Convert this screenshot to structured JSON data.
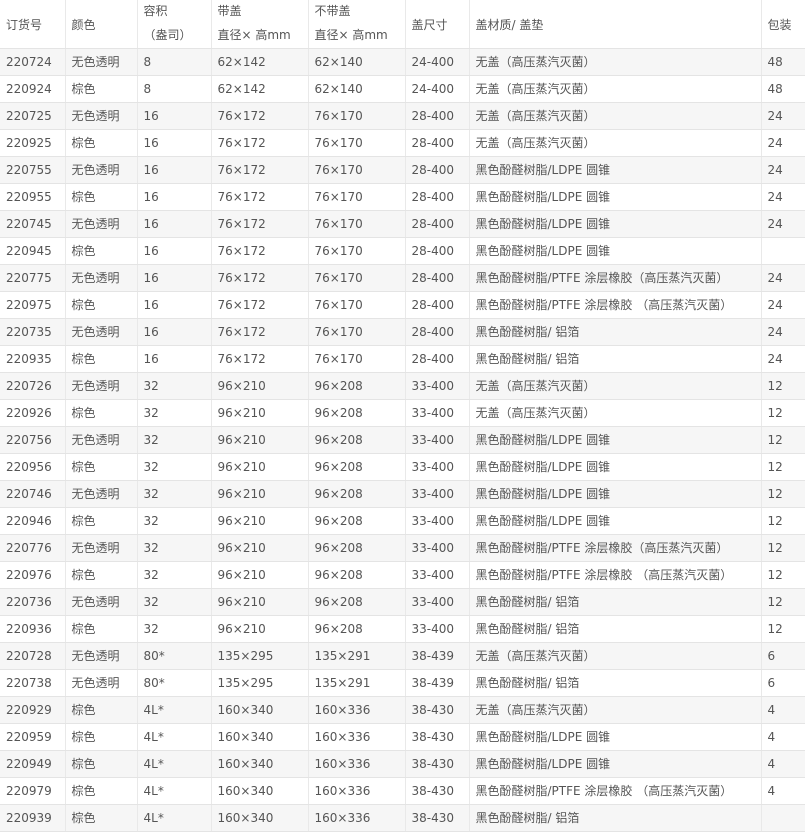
{
  "table": {
    "headers": [
      {
        "line1": "订货号",
        "line2": ""
      },
      {
        "line1": "颜色",
        "line2": ""
      },
      {
        "line1": "容积",
        "line2": "（盎司）"
      },
      {
        "line1": "带盖",
        "line2": "直径× 高mm"
      },
      {
        "line1": "不带盖",
        "line2": "直径× 高mm"
      },
      {
        "line1": "盖尺寸",
        "line2": ""
      },
      {
        "line1": "盖材质/ 盖垫",
        "line2": ""
      },
      {
        "line1": "包装",
        "line2": ""
      }
    ],
    "rows": [
      [
        "220724",
        "无色透明",
        "8",
        "62×142",
        "62×140",
        "24-400",
        "无盖（高压蒸汽灭菌）",
        "48"
      ],
      [
        "220924",
        "棕色",
        "8",
        "62×142",
        "62×140",
        "24-400",
        "无盖（高压蒸汽灭菌）",
        "48"
      ],
      [
        "220725",
        "无色透明",
        "16",
        "76×172",
        "76×170",
        "28-400",
        "无盖（高压蒸汽灭菌）",
        "24"
      ],
      [
        "220925",
        "棕色",
        "16",
        "76×172",
        "76×170",
        "28-400",
        "无盖（高压蒸汽灭菌）",
        "24"
      ],
      [
        "220755",
        "无色透明",
        "16",
        "76×172",
        "76×170",
        "28-400",
        "黑色酚醛树脂/LDPE 圆锥",
        "24"
      ],
      [
        "220955",
        "棕色",
        "16",
        "76×172",
        "76×170",
        "28-400",
        "黑色酚醛树脂/LDPE 圆锥",
        "24"
      ],
      [
        "220745",
        "无色透明",
        "16",
        "76×172",
        "76×170",
        "28-400",
        "黑色酚醛树脂/LDPE 圆锥",
        "24"
      ],
      [
        "220945",
        "棕色",
        "16",
        "76×172",
        "76×170",
        "28-400",
        "黑色酚醛树脂/LDPE 圆锥",
        ""
      ],
      [
        "220775",
        "无色透明",
        "16",
        "76×172",
        "76×170",
        "28-400",
        "黑色酚醛树脂/PTFE 涂层橡胶（高压蒸汽灭菌）",
        "24"
      ],
      [
        "220975",
        "棕色",
        "16",
        "76×172",
        "76×170",
        "28-400",
        "黑色酚醛树脂/PTFE 涂层橡胶 （高压蒸汽灭菌）",
        "24"
      ],
      [
        "220735",
        "无色透明",
        "16",
        "76×172",
        "76×170",
        "28-400",
        "黑色酚醛树脂/ 铝箔",
        "24"
      ],
      [
        "220935",
        "棕色",
        "16",
        "76×172",
        "76×170",
        "28-400",
        "黑色酚醛树脂/ 铝箔",
        "24"
      ],
      [
        "220726",
        "无色透明",
        "32",
        "96×210",
        "96×208",
        "33-400",
        "无盖（高压蒸汽灭菌）",
        "12"
      ],
      [
        "220926",
        "棕色",
        "32",
        "96×210",
        "96×208",
        "33-400",
        "无盖（高压蒸汽灭菌）",
        "12"
      ],
      [
        "220756",
        "无色透明",
        "32",
        "96×210",
        "96×208",
        "33-400",
        "黑色酚醛树脂/LDPE 圆锥",
        "12"
      ],
      [
        "220956",
        "棕色",
        "32",
        "96×210",
        "96×208",
        "33-400",
        "黑色酚醛树脂/LDPE 圆锥",
        "12"
      ],
      [
        "220746",
        "无色透明",
        "32",
        "96×210",
        "96×208",
        "33-400",
        "黑色酚醛树脂/LDPE 圆锥",
        "12"
      ],
      [
        "220946",
        "棕色",
        "32",
        "96×210",
        "96×208",
        "33-400",
        "黑色酚醛树脂/LDPE 圆锥",
        "12"
      ],
      [
        "220776",
        "无色透明",
        "32",
        "96×210",
        "96×208",
        "33-400",
        "黑色酚醛树脂/PTFE 涂层橡胶（高压蒸汽灭菌）",
        "12"
      ],
      [
        "220976",
        "棕色",
        "32",
        "96×210",
        "96×208",
        "33-400",
        "黑色酚醛树脂/PTFE 涂层橡胶 （高压蒸汽灭菌）",
        "12"
      ],
      [
        "220736",
        "无色透明",
        "32",
        "96×210",
        "96×208",
        "33-400",
        "黑色酚醛树脂/ 铝箔",
        "12"
      ],
      [
        "220936",
        "棕色",
        "32",
        "96×210",
        "96×208",
        "33-400",
        "黑色酚醛树脂/ 铝箔",
        "12"
      ],
      [
        "220728",
        "无色透明",
        "80*",
        "135×295",
        "135×291",
        "38-439",
        "无盖（高压蒸汽灭菌）",
        "6"
      ],
      [
        "220738",
        "无色透明",
        "80*",
        "135×295",
        "135×291",
        "38-439",
        "黑色酚醛树脂/ 铝箔",
        "6"
      ],
      [
        "220929",
        "棕色",
        "4L*",
        "160×340",
        "160×336",
        "38-430",
        "无盖（高压蒸汽灭菌）",
        "4"
      ],
      [
        "220959",
        "棕色",
        "4L*",
        "160×340",
        "160×336",
        "38-430",
        "黑色酚醛树脂/LDPE 圆锥",
        "4"
      ],
      [
        "220949",
        "棕色",
        "4L*",
        "160×340",
        "160×336",
        "38-430",
        "黑色酚醛树脂/LDPE 圆锥",
        "4"
      ],
      [
        "220979",
        "棕色",
        "4L*",
        "160×340",
        "160×336",
        "38-430",
        "黑色酚醛树脂/PTFE 涂层橡胶 （高压蒸汽灭菌）",
        "4"
      ],
      [
        "220939",
        "棕色",
        "4L*",
        "160×340",
        "160×336",
        "38-430",
        "黑色酚醛树脂/ 铝箔",
        ""
      ]
    ]
  }
}
